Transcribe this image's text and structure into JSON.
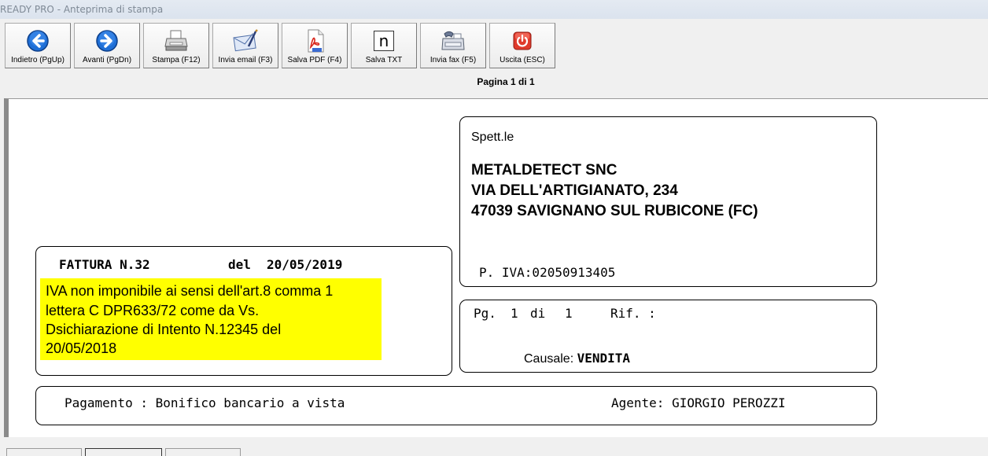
{
  "window": {
    "title": "READY PRO - Anteprima di stampa"
  },
  "toolbar": {
    "buttons": [
      {
        "label": "Indietro (PgUp)",
        "icon": "arrow-left-icon"
      },
      {
        "label": "Avanti (PgDn)",
        "icon": "arrow-right-icon"
      },
      {
        "label": "Stampa (F12)",
        "icon": "printer-icon"
      },
      {
        "label": "Invia email (F3)",
        "icon": "envelope-icon"
      },
      {
        "label": "Salva PDF (F4)",
        "icon": "pdf-icon"
      },
      {
        "label": "Salva TXT",
        "icon": "text-file-icon"
      },
      {
        "label": "Invia fax (F5)",
        "icon": "fax-icon"
      },
      {
        "label": "Uscita (ESC)",
        "icon": "power-icon"
      }
    ],
    "page_indicator": "Pagina 1 di 1",
    "icon_glyphs": {
      "txt": "n"
    }
  },
  "document": {
    "recipient": {
      "salutation": "Spett.le",
      "name": "METALDETECT SNC",
      "address": "VIA DELL'ARTIGIANATO, 234",
      "city": "47039 SAVIGNANO SUL RUBICONE (FC)",
      "vat": "P. IVA:02050913405"
    },
    "invoice": {
      "label": "FATTURA N.",
      "number": "32",
      "date_label": "del",
      "date": "20/05/2019",
      "note_lines": [
        "IVA non imponibile ai sensi dell'art.8 comma 1",
        "lettera C DPR633/72 come da Vs.",
        "Dsichiarazione di Intento N.12345 del",
        "20/05/2018"
      ]
    },
    "info": {
      "pg_label": "Pg.",
      "pg_current": "1",
      "pg_of": "di",
      "pg_total": "1",
      "rif_label": "Rif. :",
      "causale_label": "Causale:",
      "causale_value": "VENDITA"
    },
    "footer": {
      "payment_label": "Pagamento :",
      "payment_value": "Bonifico bancario a vista",
      "agent_label": "Agente:",
      "agent_value": "GIORGIO PEROZZI"
    }
  },
  "colors": {
    "highlight": "#ffff00",
    "icon_blue": "#1f6fd6",
    "exit_red": "#e03a2b"
  }
}
